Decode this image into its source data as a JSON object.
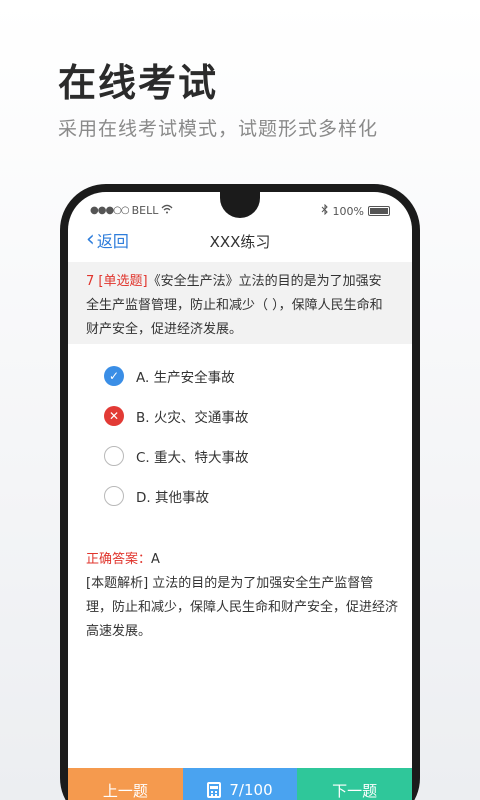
{
  "promo": {
    "title": "在线考试",
    "subtitle": "采用在线考试模式，试题形式多样化"
  },
  "status": {
    "carrier": "BELL",
    "battery": "100%"
  },
  "nav": {
    "back_label": "返回",
    "title": "XXX练习"
  },
  "question": {
    "number": "7",
    "type": "[单选题]",
    "text": "《安全生产法》立法的目的是为了加强安全生产监督管理，防止和减少（ ），保障人民生命和财产安全，促进经济发展。"
  },
  "options": [
    {
      "label": "A. 生产安全事故",
      "state": "correct"
    },
    {
      "label": "B. 火灾、交通事故",
      "state": "wrong"
    },
    {
      "label": "C. 重大、特大事故",
      "state": "unselected"
    },
    {
      "label": "D. 其他事故",
      "state": "unselected"
    }
  ],
  "answer": {
    "label": "正确答案：",
    "value": "A"
  },
  "explanation": "[本题解析] 立法的目的是为了加强安全生产监督管理，防止和减少，保障人民生命和财产安全，促进经济高速发展。",
  "bottom": {
    "prev_label": "上一题",
    "progress": "7/100",
    "next_label": "下一题"
  },
  "colors": {
    "accent": "#2e7ddb",
    "error": "#e0342c",
    "prev_button": "#f59a4e",
    "progress_button": "#4aa3f0",
    "next_button": "#2fc79a"
  }
}
